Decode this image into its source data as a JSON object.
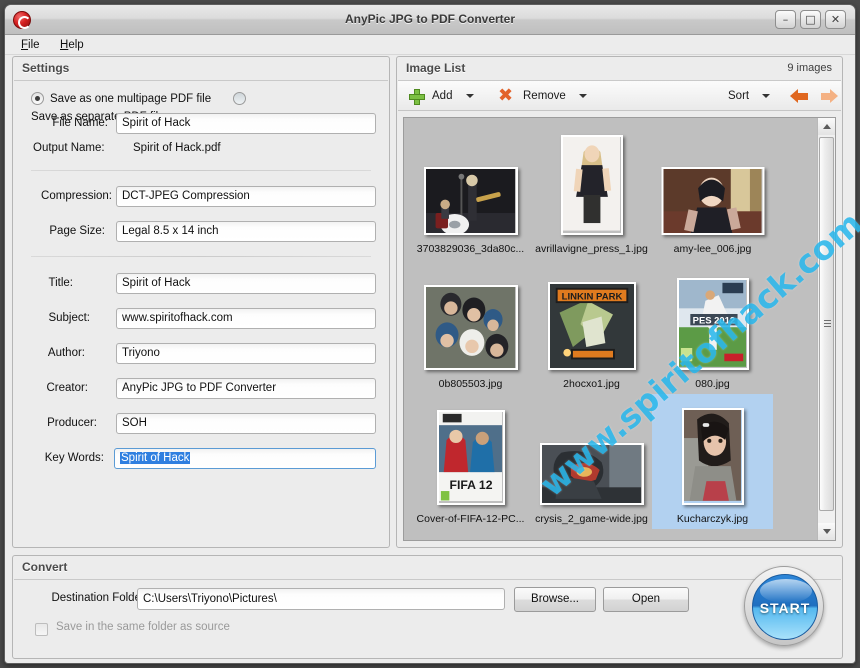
{
  "window": {
    "title": "AnyPic JPG to PDF Converter",
    "app_icon": "anypic-logo-icon",
    "minimize_label": "–",
    "maximize_label": "□",
    "close_label": "✕"
  },
  "menubar": {
    "items": [
      {
        "label": "File",
        "mnemonic": "F"
      },
      {
        "label": "Help",
        "mnemonic": "H"
      }
    ]
  },
  "settings": {
    "title": "Settings",
    "save_mode": {
      "multipage_label": "Save as one multipage PDF file",
      "separate_label": "Save as separate PDF files",
      "selected": "multipage"
    },
    "file_name": {
      "label": "File Name:",
      "value": "Spirit of Hack"
    },
    "output_name": {
      "label": "Output Name:",
      "value": "Spirit of Hack.pdf"
    },
    "compression": {
      "label": "Compression:",
      "value": "DCT-JPEG Compression"
    },
    "page_size": {
      "label": "Page Size:",
      "value": "Legal 8.5 x 14 inch"
    },
    "title_field": {
      "label": "Title:",
      "value": "Spirit of Hack"
    },
    "subject": {
      "label": "Subject:",
      "value": "www.spiritofhack.com"
    },
    "author": {
      "label": "Author:",
      "value": "Triyono"
    },
    "creator": {
      "label": "Creator:",
      "value": "AnyPic JPG to PDF Converter"
    },
    "producer": {
      "label": "Producer:",
      "value": "SOH"
    },
    "keywords": {
      "label": "Key Words:",
      "value": "Spirit of Hack",
      "selected": true
    }
  },
  "image_list": {
    "title": "Image List",
    "count_label": "9 images",
    "toolbar": {
      "add_label": "Add",
      "add_icon": "plus-icon",
      "remove_label": "Remove",
      "remove_icon": "x-icon",
      "sort_label": "Sort",
      "prev_icon": "arrow-left-icon",
      "next_icon": "arrow-right-icon"
    },
    "items": [
      {
        "name": "3703829036_3da80c...",
        "selected": false,
        "art": "band"
      },
      {
        "name": "avrillavigne_press_1.jpg",
        "selected": false,
        "art": "avril"
      },
      {
        "name": "amy-lee_006.jpg",
        "selected": false,
        "art": "amy"
      },
      {
        "name": "0b805503.jpg",
        "selected": false,
        "art": "group"
      },
      {
        "name": "2hocxo1.jpg",
        "selected": false,
        "art": "linkin"
      },
      {
        "name": "080.jpg",
        "selected": false,
        "art": "pes"
      },
      {
        "name": "Cover-of-FIFA-12-PC...",
        "selected": false,
        "art": "fifa"
      },
      {
        "name": "crysis_2_game-wide.jpg",
        "selected": false,
        "art": "crysis"
      },
      {
        "name": "Kucharczyk.jpg",
        "selected": true,
        "art": "girl"
      }
    ]
  },
  "convert": {
    "title": "Convert",
    "destination": {
      "label": "Destination Folder:",
      "value": "C:\\Users\\Triyono\\Pictures\\"
    },
    "browse_label": "Browse...",
    "open_label": "Open",
    "same_folder_label": "Save in the same folder as source",
    "same_folder_checked": false,
    "start_label": "START"
  },
  "watermark": {
    "text": "www.spiritofhack.com",
    "color": "#2cb8ec"
  },
  "colors": {
    "window_bg": "#ececec",
    "panel_border": "#b5b5b5",
    "selection_blue": "#b2d1f0",
    "text_selection": "#2f7fe0",
    "accent_orange": "#e0671f",
    "start_blue": "#2d86d8"
  }
}
